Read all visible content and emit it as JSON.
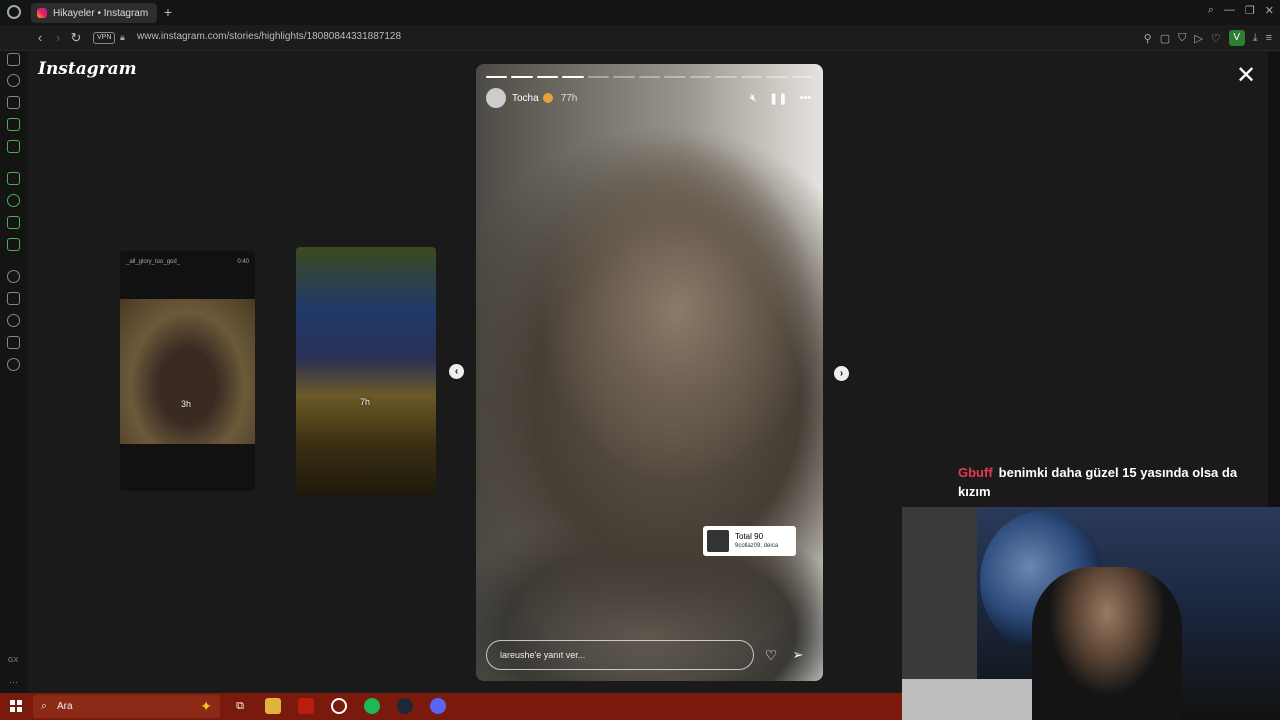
{
  "browser": {
    "tab_title": "Hikayeler • Instagram",
    "new_tab": "+",
    "vpn": "VPN",
    "url": "www.instagram.com/stories/highlights/18080844331887128",
    "profile_initial": "V"
  },
  "instagram": {
    "logo": "Instagram",
    "close": "✕"
  },
  "thumbnails": [
    {
      "account": "_all_glory_too_god_",
      "duration": "0:40",
      "time": "3h"
    },
    {
      "time": "7h"
    }
  ],
  "story": {
    "username": "Tocha",
    "time": "77h",
    "segments_total": 13,
    "segments_done": 4,
    "sticker_title": "Total 90",
    "sticker_sub": "9collaz09, deica",
    "reply_placeholder": "lareushe'e yanıt ver..."
  },
  "chat": {
    "user": "Gbuff",
    "message": "benimki daha güzel 15 yasında olsa da kızım"
  },
  "taskbar": {
    "search_placeholder": "Ara"
  },
  "colors": {
    "chat_user": "#e53950",
    "taskbar": "#7a1a0c"
  }
}
